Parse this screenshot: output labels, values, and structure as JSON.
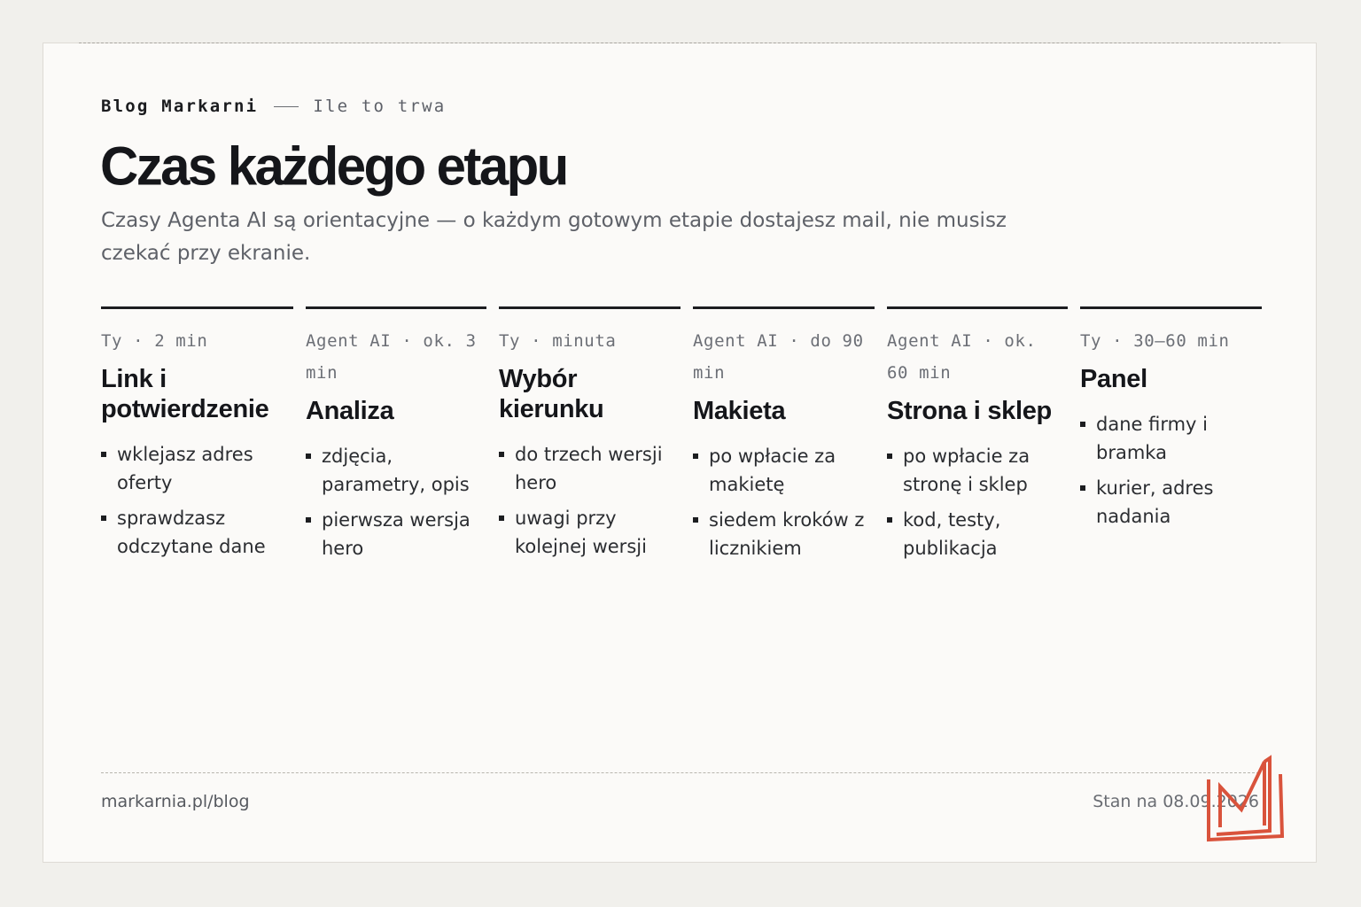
{
  "header": {
    "brand": "Blog Markarni",
    "section": "Ile to trwa",
    "title": "Czas każdego etapu",
    "subtitle": "Czasy Agenta AI są orientacyjne — o każdym gotowym etapie dostajesz mail, nie musisz czekać przy ekranie."
  },
  "stages": [
    {
      "meta": "Ty · 2 min",
      "title": "Link i potwierdzenie",
      "bullets": [
        "wklejasz adres oferty",
        "sprawdzasz odczytane dane"
      ]
    },
    {
      "meta": "Agent AI · ok. 3 min",
      "title": "Analiza",
      "bullets": [
        "zdjęcia, parametry, opis",
        "pierwsza wersja hero"
      ]
    },
    {
      "meta": "Ty · minuta",
      "title": "Wybór kierunku",
      "bullets": [
        "do trzech wersji hero",
        "uwagi przy kolejnej wersji"
      ]
    },
    {
      "meta": "Agent AI · do 90 min",
      "title": "Makieta",
      "bullets": [
        "po wpłacie za makietę",
        "siedem kroków z licznikiem"
      ]
    },
    {
      "meta": "Agent AI · ok. 60 min",
      "title": "Strona i sklep",
      "bullets": [
        "po wpłacie za stronę i sklep",
        "kod, testy, publikacja"
      ]
    },
    {
      "meta": "Ty · 30–60 min",
      "title": "Panel",
      "bullets": [
        "dane firmy i bramka",
        "kurier, adres nadania"
      ]
    }
  ],
  "footer": {
    "url": "markarnia.pl/blog",
    "status": "Stan na 08.09.2026"
  },
  "colors": {
    "background": "#f1f0ec",
    "card": "#fbfaf8",
    "text": "#17181b",
    "muted": "#5e6168",
    "logo": "#d9533c"
  },
  "icons": {
    "logo": "markarnia-m-logo"
  }
}
